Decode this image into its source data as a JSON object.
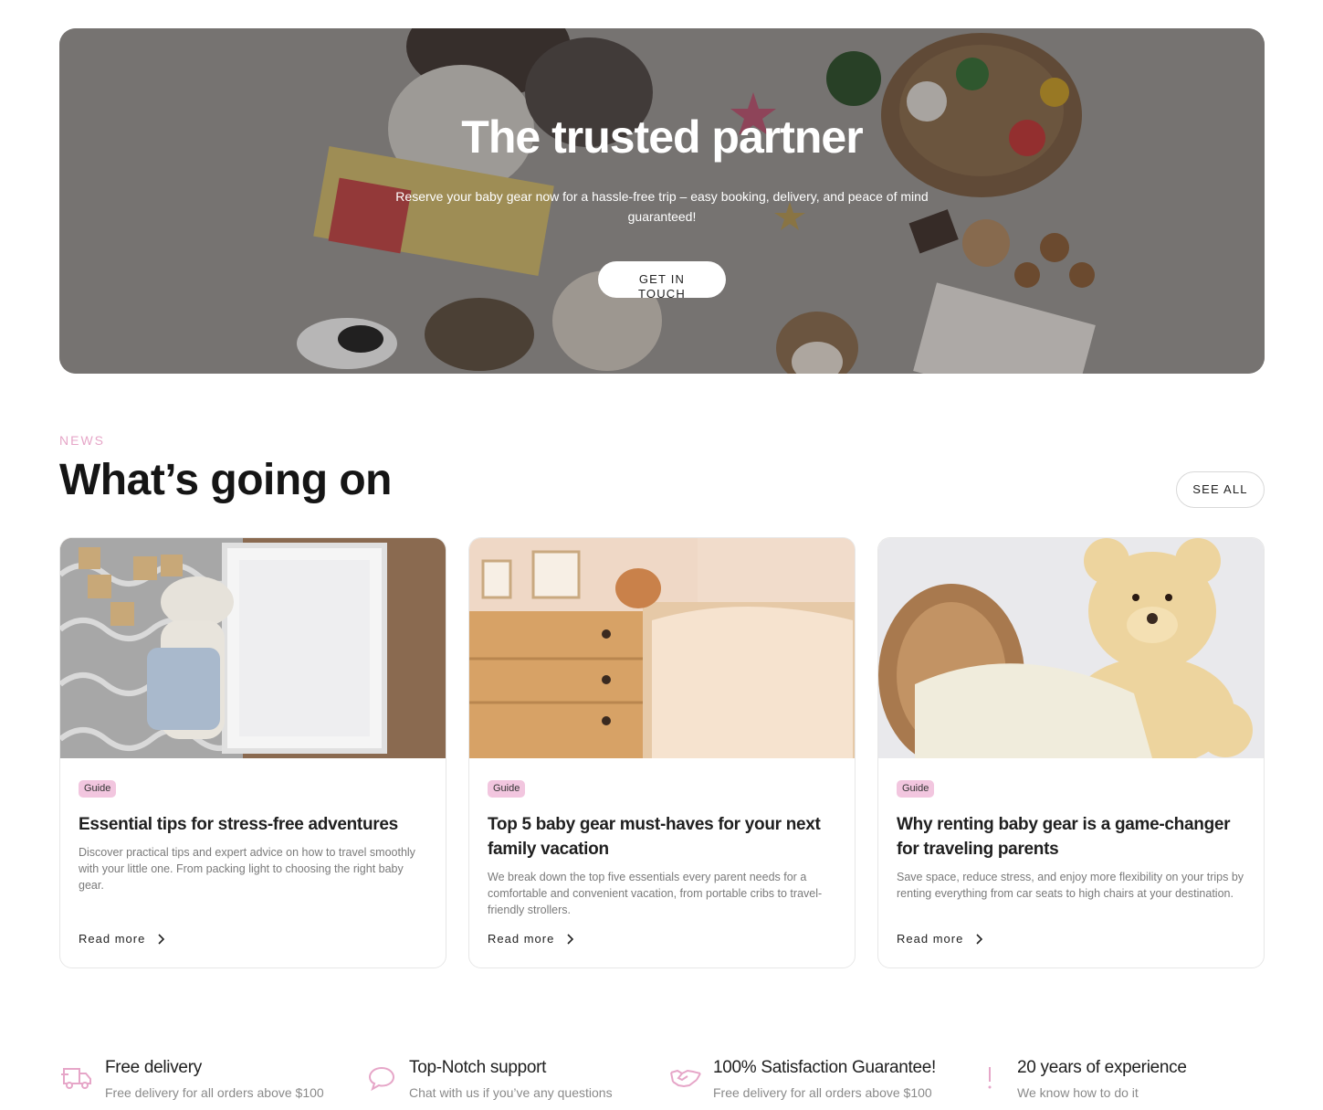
{
  "hero": {
    "title": "The trusted partner",
    "subtitle": "Reserve your baby gear now for a hassle-free trip – easy booking, delivery, and peace of mind guaranteed!",
    "cta_label": "GET IN TOUCH"
  },
  "news": {
    "eyebrow": "NEWS",
    "title": "What’s going on",
    "see_all_label": "SEE ALL",
    "cards": [
      {
        "tag": "Guide",
        "title": "Essential tips for stress-free adventures",
        "description": "Discover practical tips and expert advice on how to travel smoothly with your little one. From packing light to choosing the right baby gear.",
        "read_more": "Read more",
        "image": "plush-bunny-with-blocks-and-frame"
      },
      {
        "tag": "Guide",
        "title": "Top 5 baby gear must-haves for your next family vacation",
        "description": "We break down the top five essentials every parent needs for a comfortable and convenient vacation, from portable cribs to travel-friendly strollers.",
        "read_more": "Read more",
        "image": "nursery-dresser-and-crib"
      },
      {
        "tag": "Guide",
        "title": "Why renting baby gear is a game-changer for traveling parents",
        "description": "Save space, reduce stress, and enjoy more flexibility on your trips by renting everything from car seats to high chairs at your destination.",
        "read_more": "Read more",
        "image": "teddy-bear-with-basket-and-blanket"
      }
    ]
  },
  "features": [
    {
      "icon": "delivery-truck-icon",
      "title": "Free delivery",
      "subtitle": "Free delivery for all orders above $100"
    },
    {
      "icon": "chat-bubble-icon",
      "title": "Top-Notch support",
      "subtitle": "Chat with us if you’ve any questions"
    },
    {
      "icon": "handshake-icon",
      "title": "100% Satisfaction Guarantee!",
      "subtitle": "Free delivery for all orders above $100"
    },
    {
      "icon": "exclamation-icon",
      "title": "20 years of experience",
      "subtitle": "We know how to do it"
    }
  ],
  "colors": {
    "accent_pink": "#e6a6c8",
    "tag_bg": "#f2c6df"
  }
}
